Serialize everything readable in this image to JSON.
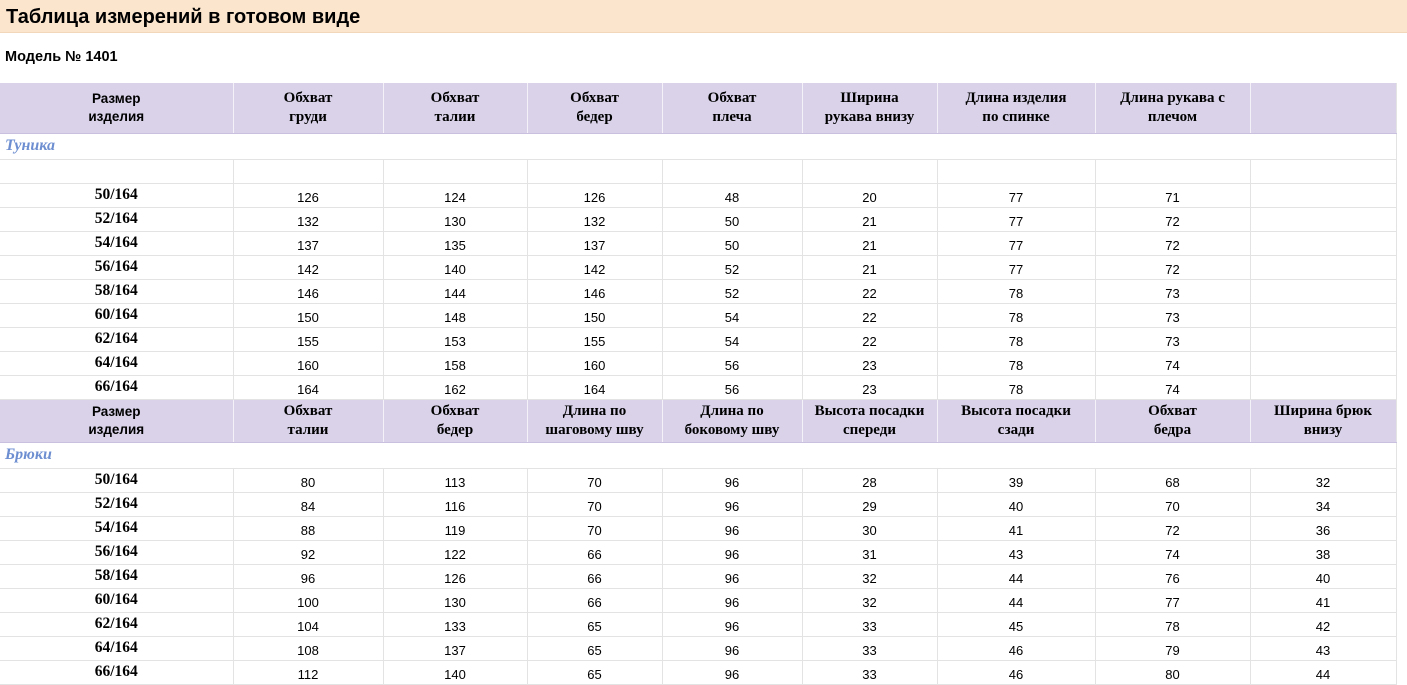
{
  "title": "Таблица измерений в готовом виде",
  "model": "Модель № 1401",
  "tunic": {
    "headers": [
      [
        "Размер",
        "изделия"
      ],
      [
        "Обхват",
        "груди"
      ],
      [
        "Обхват",
        "талии"
      ],
      [
        "Обхват",
        "бедер"
      ],
      [
        "Обхват",
        "плеча"
      ],
      [
        "Ширина",
        "рукава внизу"
      ],
      [
        "Длина изделия",
        "по спинке"
      ],
      [
        "Длина рукава с",
        "плечом"
      ],
      [
        "",
        ""
      ]
    ],
    "section_label": "Туника",
    "rows": [
      [
        "50/164",
        "126",
        "124",
        "126",
        "48",
        "20",
        "77",
        "71",
        ""
      ],
      [
        "52/164",
        "132",
        "130",
        "132",
        "50",
        "21",
        "77",
        "72",
        ""
      ],
      [
        "54/164",
        "137",
        "135",
        "137",
        "50",
        "21",
        "77",
        "72",
        ""
      ],
      [
        "56/164",
        "142",
        "140",
        "142",
        "52",
        "21",
        "77",
        "72",
        ""
      ],
      [
        "58/164",
        "146",
        "144",
        "146",
        "52",
        "22",
        "78",
        "73",
        ""
      ],
      [
        "60/164",
        "150",
        "148",
        "150",
        "54",
        "22",
        "78",
        "73",
        ""
      ],
      [
        "62/164",
        "155",
        "153",
        "155",
        "54",
        "22",
        "78",
        "73",
        ""
      ],
      [
        "64/164",
        "160",
        "158",
        "160",
        "56",
        "23",
        "78",
        "74",
        ""
      ],
      [
        "66/164",
        "164",
        "162",
        "164",
        "56",
        "23",
        "78",
        "74",
        ""
      ]
    ]
  },
  "trousers": {
    "headers": [
      [
        "Размер",
        "изделия"
      ],
      [
        "Обхват",
        "талии"
      ],
      [
        "Обхват",
        "бедер"
      ],
      [
        "Длина по",
        "шаговому шву"
      ],
      [
        "Длина по",
        "боковому шву"
      ],
      [
        "Высота посадки",
        "спереди"
      ],
      [
        "Высота посадки",
        "сзади"
      ],
      [
        "Обхват",
        "бедра"
      ],
      [
        "Ширина брюк",
        "внизу"
      ]
    ],
    "section_label": "Брюки",
    "rows": [
      [
        "50/164",
        "80",
        "113",
        "70",
        "96",
        "28",
        "39",
        "68",
        "32"
      ],
      [
        "52/164",
        "84",
        "116",
        "70",
        "96",
        "29",
        "40",
        "70",
        "34"
      ],
      [
        "54/164",
        "88",
        "119",
        "70",
        "96",
        "30",
        "41",
        "72",
        "36"
      ],
      [
        "56/164",
        "92",
        "122",
        "66",
        "96",
        "31",
        "43",
        "74",
        "38"
      ],
      [
        "58/164",
        "96",
        "126",
        "66",
        "96",
        "32",
        "44",
        "76",
        "40"
      ],
      [
        "60/164",
        "100",
        "130",
        "66",
        "96",
        "32",
        "44",
        "77",
        "41"
      ],
      [
        "62/164",
        "104",
        "133",
        "65",
        "96",
        "33",
        "45",
        "78",
        "42"
      ],
      [
        "64/164",
        "108",
        "137",
        "65",
        "96",
        "33",
        "46",
        "79",
        "43"
      ],
      [
        "66/164",
        "112",
        "140",
        "65",
        "96",
        "33",
        "46",
        "80",
        "44"
      ]
    ]
  },
  "colors": {
    "title_bg": "#fce5cd",
    "header_bg": "#d9d2e9",
    "section_label": "#6d8ed0"
  }
}
